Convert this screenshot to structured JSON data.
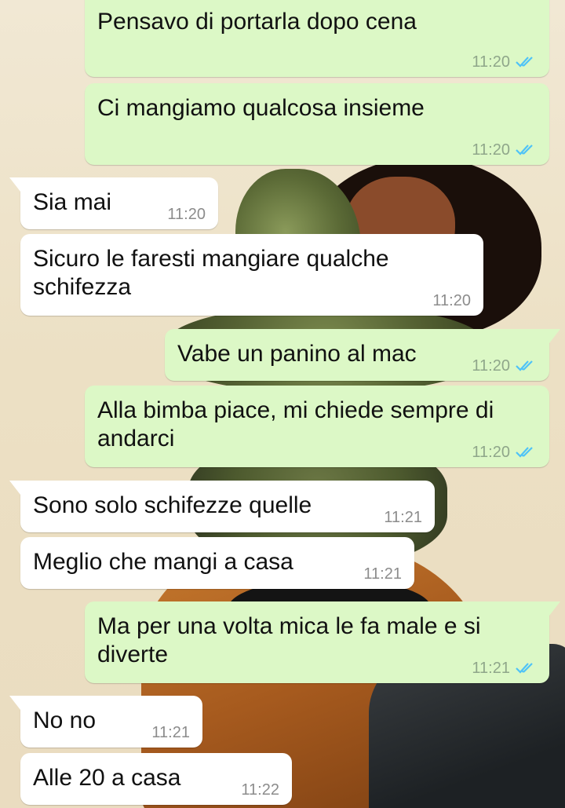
{
  "colors": {
    "outgoing_bubble": "#dcf8c6",
    "incoming_bubble": "#ffffff",
    "read_ticks": "#4fc3f7"
  },
  "messages": [
    {
      "direction": "out",
      "text": "Pensavo di portarla dopo cena",
      "time": "11:20",
      "status": "read"
    },
    {
      "direction": "out",
      "text": "Ci mangiamo qualcosa insieme",
      "time": "11:20",
      "status": "read"
    },
    {
      "direction": "in",
      "text": "Sia mai",
      "time": "11:20"
    },
    {
      "direction": "in",
      "text": "Sicuro le faresti mangiare qualche\nschifezza",
      "time": "11:20"
    },
    {
      "direction": "out",
      "text": "Vabe un panino al mac",
      "time": "11:20",
      "status": "read"
    },
    {
      "direction": "out",
      "text": "Alla bimba piace, mi chiede sempre di\nandarci",
      "time": "11:20",
      "status": "read"
    },
    {
      "direction": "in",
      "text": "Sono solo schifezze quelle",
      "time": "11:21"
    },
    {
      "direction": "in",
      "text": "Meglio che mangi a casa",
      "time": "11:21"
    },
    {
      "direction": "out",
      "text": "Ma per una volta mica le fa male e si\ndiverte",
      "time": "11:21",
      "status": "read"
    },
    {
      "direction": "in",
      "text": "No no",
      "time": "11:21"
    },
    {
      "direction": "in",
      "text": "Alle 20 a casa",
      "time": "11:22"
    }
  ]
}
